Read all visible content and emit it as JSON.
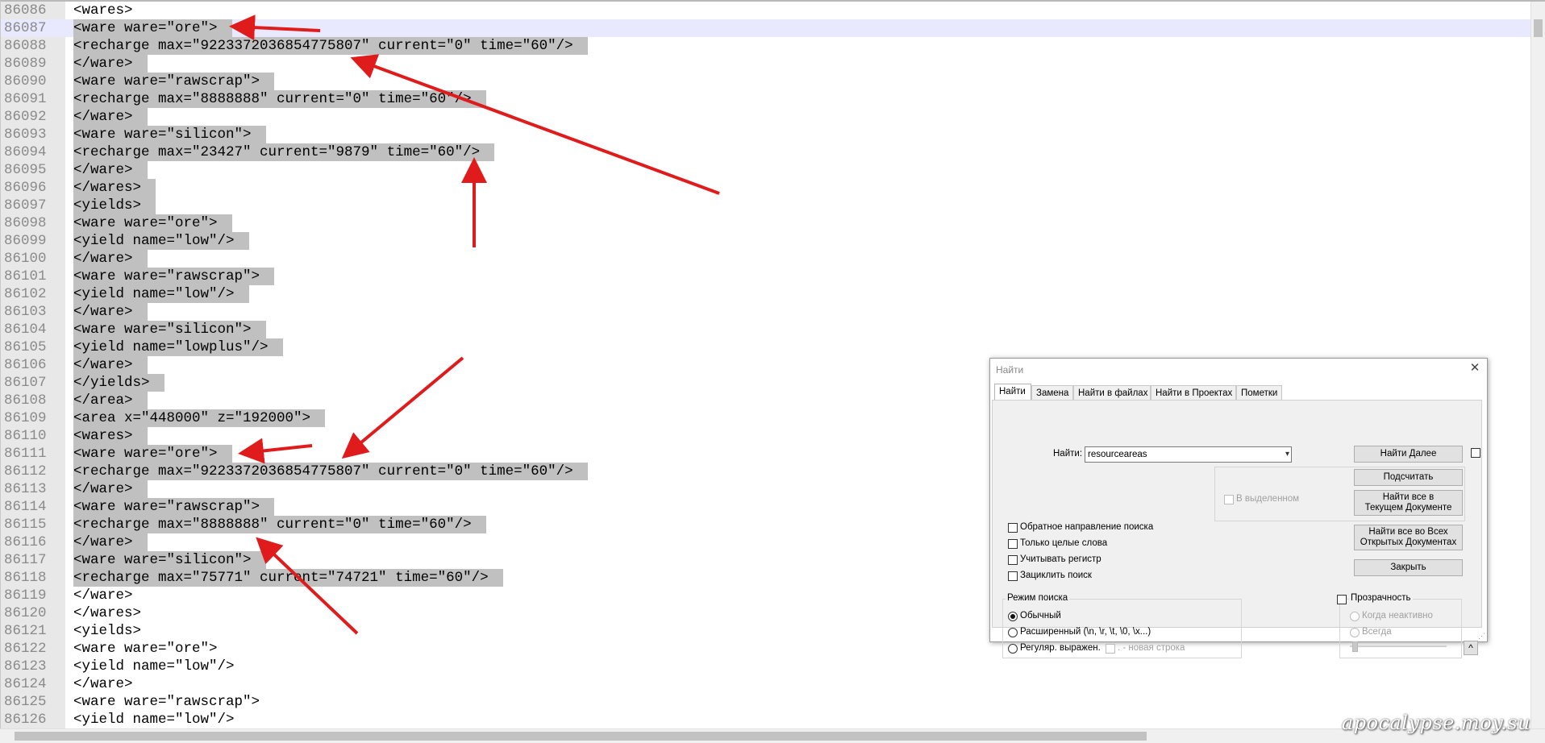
{
  "editor": {
    "lines": [
      {
        "num": "86086",
        "text": "<wares>",
        "sel": false
      },
      {
        "num": "86087",
        "text": "<ware ware=\"ore\">",
        "sel": true,
        "current": true
      },
      {
        "num": "86088",
        "text": "<recharge max=\"9223372036854775807\" current=\"0\" time=\"60\"/>",
        "sel": true
      },
      {
        "num": "86089",
        "text": "</ware>",
        "sel": true
      },
      {
        "num": "86090",
        "text": "<ware ware=\"rawscrap\">",
        "sel": true
      },
      {
        "num": "86091",
        "text": "<recharge max=\"8888888\" current=\"0\" time=\"60\"/>",
        "sel": true
      },
      {
        "num": "86092",
        "text": "</ware>",
        "sel": true
      },
      {
        "num": "86093",
        "text": "<ware ware=\"silicon\">",
        "sel": true
      },
      {
        "num": "86094",
        "text": "<recharge max=\"23427\" current=\"9879\" time=\"60\"/>",
        "sel": true
      },
      {
        "num": "86095",
        "text": "</ware>",
        "sel": true
      },
      {
        "num": "86096",
        "text": "</wares>",
        "sel": true
      },
      {
        "num": "86097",
        "text": "<yields>",
        "sel": true
      },
      {
        "num": "86098",
        "text": "<ware ware=\"ore\">",
        "sel": true
      },
      {
        "num": "86099",
        "text": "<yield name=\"low\"/>",
        "sel": true
      },
      {
        "num": "86100",
        "text": "</ware>",
        "sel": true
      },
      {
        "num": "86101",
        "text": "<ware ware=\"rawscrap\">",
        "sel": true
      },
      {
        "num": "86102",
        "text": "<yield name=\"low\"/>",
        "sel": true
      },
      {
        "num": "86103",
        "text": "</ware>",
        "sel": true
      },
      {
        "num": "86104",
        "text": "<ware ware=\"silicon\">",
        "sel": true
      },
      {
        "num": "86105",
        "text": "<yield name=\"lowplus\"/>",
        "sel": true
      },
      {
        "num": "86106",
        "text": "</ware>",
        "sel": true
      },
      {
        "num": "86107",
        "text": "</yields>",
        "sel": true
      },
      {
        "num": "86108",
        "text": "</area>",
        "sel": true
      },
      {
        "num": "86109",
        "text": "<area x=\"448000\" z=\"192000\">",
        "sel": true
      },
      {
        "num": "86110",
        "text": "<wares>",
        "sel": true
      },
      {
        "num": "86111",
        "text": "<ware ware=\"ore\">",
        "sel": true
      },
      {
        "num": "86112",
        "text": "<recharge max=\"9223372036854775807\" current=\"0\" time=\"60\"/>",
        "sel": true
      },
      {
        "num": "86113",
        "text": "</ware>",
        "sel": true
      },
      {
        "num": "86114",
        "text": "<ware ware=\"rawscrap\">",
        "sel": true
      },
      {
        "num": "86115",
        "text": "<recharge max=\"8888888\" current=\"0\" time=\"60\"/>",
        "sel": true
      },
      {
        "num": "86116",
        "text": "</ware>",
        "sel": true
      },
      {
        "num": "86117",
        "text": "<ware ware=\"silicon\">",
        "sel": true
      },
      {
        "num": "86118",
        "text": "<recharge max=\"75771\" current=\"74721\" time=\"60\"/>",
        "sel": true
      },
      {
        "num": "86119",
        "text": "</ware>",
        "sel": false
      },
      {
        "num": "86120",
        "text": "</wares>",
        "sel": false
      },
      {
        "num": "86121",
        "text": "<yields>",
        "sel": false
      },
      {
        "num": "86122",
        "text": "<ware ware=\"ore\">",
        "sel": false
      },
      {
        "num": "86123",
        "text": "<yield name=\"low\"/>",
        "sel": false
      },
      {
        "num": "86124",
        "text": "</ware>",
        "sel": false
      },
      {
        "num": "86125",
        "text": "<ware ware=\"rawscrap\">",
        "sel": false
      },
      {
        "num": "86126",
        "text": "<yield name=\"low\"/>",
        "sel": false
      }
    ]
  },
  "watermark": "apocalypse.moy.su",
  "annotation_color": "#e01b1b",
  "find_dialog": {
    "title": "Найти",
    "close_icon": "close-icon",
    "tabs": [
      "Найти",
      "Замена",
      "Найти в файлах",
      "Найти в Проектах",
      "Пометки"
    ],
    "find_label": "Найти:",
    "find_value": "resourceareas",
    "in_selection_label": "В выделенном",
    "buttons": {
      "find_next": "Найти Далее",
      "count": "Подсчитать",
      "find_all_current_1": "Найти все в",
      "find_all_current_2": "Текущем Документе",
      "find_all_open_1": "Найти все во Всех",
      "find_all_open_2": "Открытых Документах",
      "close": "Закрыть"
    },
    "options": {
      "backward": "Обратное направление поиска",
      "whole_word": "Только целые слова",
      "match_case": "Учитывать регистр",
      "wrap": "Зациклить поиск"
    },
    "search_mode": {
      "legend": "Режим поиска",
      "normal": "Обычный",
      "extended": "Расширенный (\\n, \\r, \\t, \\0, \\x...)",
      "regex": "Регуляр. выражен.",
      "newline_label": ". - новая строка"
    },
    "transparency": {
      "legend": "Прозрачность",
      "on_lose_focus": "Когда неактивно",
      "always": "Всегда"
    },
    "collapse_icon": "chevron-up-icon"
  }
}
